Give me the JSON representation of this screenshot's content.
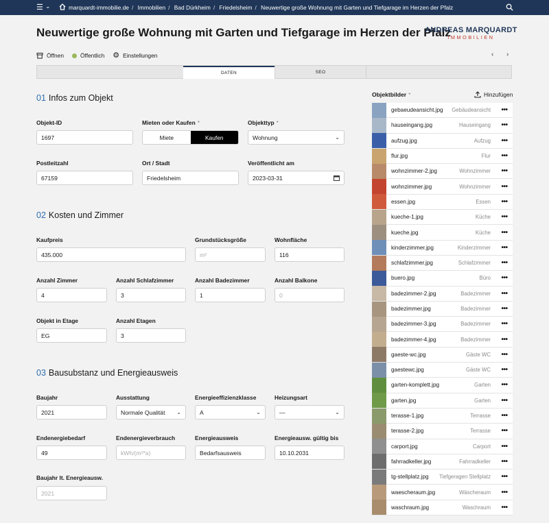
{
  "topbar": {
    "breadcrumbs": [
      "marquardt-immobilie.de",
      "Immobilien",
      "Bad Dürkheim",
      "Friedelsheim",
      "Neuwertige große Wohnung mit Garten und Tiefgarage im Herzen der Pfalz"
    ]
  },
  "page_title": "Neuwertige große Wohnung mit Garten und Tiefgarage im Herzen der Pfalz",
  "logo": {
    "line1": "ANDREAS MARQUARDT",
    "line2": "IMMOBILIEN"
  },
  "toolbar": {
    "open": "Öffnen",
    "public": "Öffentlich",
    "settings": "Einstellungen"
  },
  "tabs": {
    "data": "DATEN",
    "seo": "SEO"
  },
  "sections": {
    "s1": {
      "num": "01",
      "title": "Infos zum Objekt"
    },
    "s2": {
      "num": "02",
      "title": "Kosten und Zimmer"
    },
    "s3": {
      "num": "03",
      "title": "Bausubstanz und Energieausweis"
    }
  },
  "fields": {
    "objekt_id": {
      "label": "Objekt-ID",
      "value": "1697"
    },
    "mieten_kaufen": {
      "label": "Mieten oder Kaufen",
      "req": "*",
      "options": [
        "Miete",
        "Kaufen"
      ],
      "selected": "Kaufen"
    },
    "objekttyp": {
      "label": "Objekttyp",
      "req": "*",
      "value": "Wohnung"
    },
    "plz": {
      "label": "Postleitzahl",
      "value": "67159"
    },
    "ort": {
      "label": "Ort / Stadt",
      "value": "Friedelsheim"
    },
    "veroeffentlicht": {
      "label": "Veröffentlicht am",
      "value": "2023-03-31"
    },
    "kaufpreis": {
      "label": "Kaufpreis",
      "value": "435.000"
    },
    "grundstueck": {
      "label": "Grundstücksgröße",
      "placeholder": "m²"
    },
    "wohnflaeche": {
      "label": "Wohnfläche",
      "value": "116"
    },
    "zimmer": {
      "label": "Anzahl Zimmer",
      "value": "4"
    },
    "schlafzimmer": {
      "label": "Anzahl Schlafzimmer",
      "value": "3"
    },
    "badezimmer": {
      "label": "Anzahl Badezimmer",
      "value": "1"
    },
    "balkone": {
      "label": "Anzahl Balkone",
      "placeholder": "0"
    },
    "etage": {
      "label": "Objekt in Etage",
      "value": "EG"
    },
    "etagen": {
      "label": "Anzahl Etagen",
      "value": "3"
    },
    "baujahr": {
      "label": "Baujahr",
      "value": "2021"
    },
    "ausstattung": {
      "label": "Ausstattung",
      "value": "Normale Qualität"
    },
    "effizienz": {
      "label": "Energieeffizienzklasse",
      "value": "A"
    },
    "heizung": {
      "label": "Heizungsart",
      "value": "—"
    },
    "endbedarf": {
      "label": "Endenergiebedarf",
      "value": "49"
    },
    "endverbrauch": {
      "label": "Endenergieverbrauch",
      "placeholder": "kWh/(m²*a)"
    },
    "ausweis": {
      "label": "Energieausweis",
      "value": "Bedarfsausweis"
    },
    "gueltig": {
      "label": "Energieausw. gültig bis",
      "value": "10.10.2031"
    },
    "baujahr_ausweis": {
      "label": "Baujahr lt. Energieausw.",
      "placeholder": "2021"
    }
  },
  "images": {
    "title": "Objektbilder",
    "req": "*",
    "add_label": "Hinzufügen",
    "items": [
      {
        "file": "gebaeudeansicht.jpg",
        "caption": "Gebäudeansicht",
        "color": "#8aa3c0"
      },
      {
        "file": "hauseingang.jpg",
        "caption": "Hauseingang",
        "color": "#a9b8c9"
      },
      {
        "file": "aufzug.jpg",
        "caption": "Aufzug",
        "color": "#3a5fa8"
      },
      {
        "file": "flur.jpg",
        "caption": "Flur",
        "color": "#c9a46e"
      },
      {
        "file": "wohnzimmer-2.jpg",
        "caption": "Wohnzimmer",
        "color": "#b88a6a"
      },
      {
        "file": "wohnzimmer.jpg",
        "caption": "Wohnzimmer",
        "color": "#c4452f"
      },
      {
        "file": "essen.jpg",
        "caption": "Essen",
        "color": "#d05a3c"
      },
      {
        "file": "kueche-1.jpg",
        "caption": "Küche",
        "color": "#b7a48b"
      },
      {
        "file": "kueche.jpg",
        "caption": "Küche",
        "color": "#9d8f80"
      },
      {
        "file": "kinderzimmer.jpg",
        "caption": "Kinderzimmer",
        "color": "#6f8fb8"
      },
      {
        "file": "schlafzimmer.jpg",
        "caption": "Schlafzimmer",
        "color": "#b37a5c"
      },
      {
        "file": "buero.jpg",
        "caption": "Büro",
        "color": "#3c5a99"
      },
      {
        "file": "badezimmer-2.jpg",
        "caption": "Badezimmer",
        "color": "#c7b9a6"
      },
      {
        "file": "badezimmer.jpg",
        "caption": "Badezimmer",
        "color": "#a7957f"
      },
      {
        "file": "badezimmer-3.jpg",
        "caption": "Badezimmer",
        "color": "#b6a590"
      },
      {
        "file": "badezimmer-4.jpg",
        "caption": "Badezimmer",
        "color": "#c2ad8f"
      },
      {
        "file": "gaeste-wc.jpg",
        "caption": "Gäste WC",
        "color": "#8d7a66"
      },
      {
        "file": "gaestewc.jpg",
        "caption": "Gäste WC",
        "color": "#7c8fa8"
      },
      {
        "file": "garten-komplett.jpg",
        "caption": "Garten",
        "color": "#5f8f3e"
      },
      {
        "file": "garten.jpg",
        "caption": "Garten",
        "color": "#6f9a48"
      },
      {
        "file": "terasse-1.jpg",
        "caption": "Terrasse",
        "color": "#8b9a6a"
      },
      {
        "file": "terasse-2.jpg",
        "caption": "Terrasse",
        "color": "#9a8c70"
      },
      {
        "file": "carport.jpg",
        "caption": "Carport",
        "color": "#8f8f8f"
      },
      {
        "file": "fahrradkeller.jpg",
        "caption": "Fahrradkeller",
        "color": "#6d6d6d"
      },
      {
        "file": "tg-stellplatz.jpg",
        "caption": "Tiefgeragen Stellplatz",
        "color": "#7a7a7a"
      },
      {
        "file": "waescheraum.jpg",
        "caption": "Wäscheraum",
        "color": "#b89a7a"
      },
      {
        "file": "waschraum.jpg",
        "caption": "Waschraum",
        "color": "#a88c6c"
      }
    ]
  }
}
